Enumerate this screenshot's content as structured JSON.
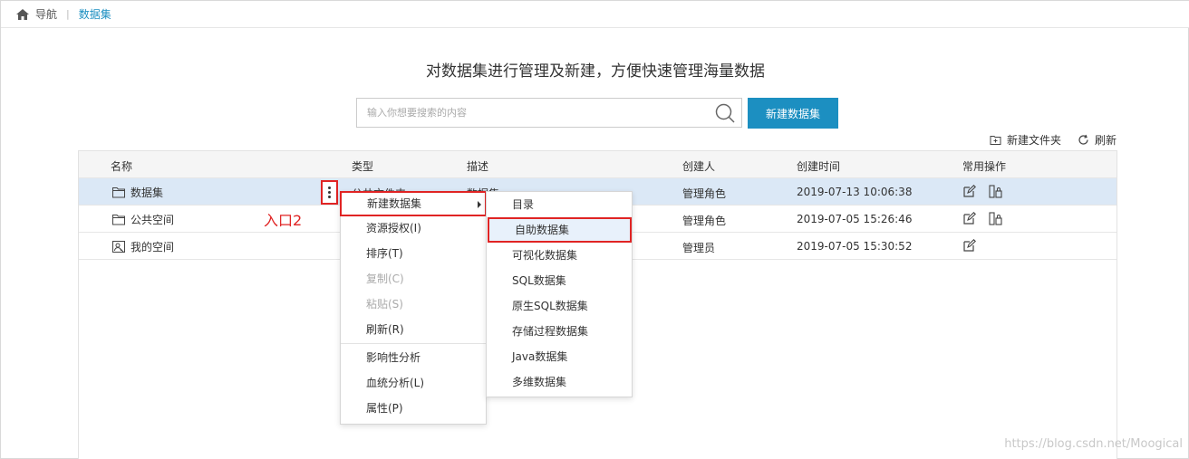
{
  "breadcrumb": {
    "home_label": "导航",
    "current": "数据集"
  },
  "headline": "对数据集进行管理及新建，方便快速管理海量数据",
  "search": {
    "placeholder": "输入你想要搜索的内容",
    "value": ""
  },
  "toolbar": {
    "new_button": "新建数据集",
    "new_folder": "新建文件夹",
    "refresh": "刷新"
  },
  "table": {
    "columns": [
      "名称",
      "类型",
      "描述",
      "创建人",
      "创建时间",
      "常用操作"
    ],
    "rows": [
      {
        "name": "数据集",
        "type": "公共文件夹",
        "desc": "数据集",
        "creator": "管理角色",
        "created": "2019-07-13 10:06:38"
      },
      {
        "name": "公共空间",
        "type": "",
        "desc": "",
        "creator": "管理角色",
        "created": "2019-07-05 15:26:46"
      },
      {
        "name": "我的空间",
        "type": "",
        "desc": "",
        "creator": "管理员",
        "created": "2019-07-05 15:30:52"
      }
    ]
  },
  "annotation": "入口2",
  "context_menu": {
    "items": [
      {
        "label": "新建数据集"
      },
      {
        "label": "资源授权(I)"
      },
      {
        "label": "排序(T)"
      },
      {
        "label": "复制(C)"
      },
      {
        "label": "粘贴(S)"
      },
      {
        "label": "刷新(R)"
      },
      {
        "label": "影响性分析"
      },
      {
        "label": "血统分析(L)"
      },
      {
        "label": "属性(P)"
      }
    ]
  },
  "submenu": {
    "items": [
      {
        "label": "目录"
      },
      {
        "label": "自助数据集"
      },
      {
        "label": "可视化数据集"
      },
      {
        "label": "SQL数据集"
      },
      {
        "label": "原生SQL数据集"
      },
      {
        "label": "存储过程数据集"
      },
      {
        "label": "Java数据集"
      },
      {
        "label": "多维数据集"
      }
    ]
  },
  "watermark": "https://blog.csdn.net/Moogical",
  "colors": {
    "accent": "#1c8fc1",
    "highlight_border": "#e02424",
    "selected_row": "#dbe8f6"
  }
}
